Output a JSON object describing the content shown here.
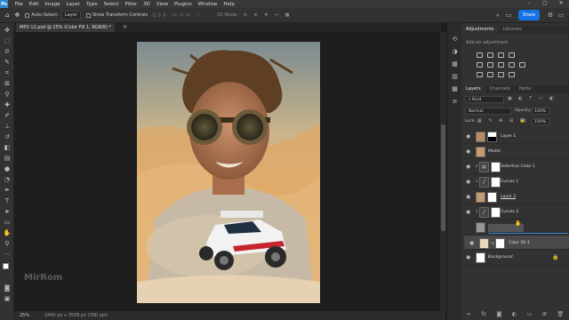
{
  "menubar": {
    "logo": "Ps",
    "items": [
      "File",
      "Edit",
      "Image",
      "Layer",
      "Type",
      "Select",
      "Filter",
      "3D",
      "View",
      "Plugins",
      "Window",
      "Help"
    ],
    "window_controls": [
      "–",
      "▢",
      "✕"
    ]
  },
  "options": {
    "auto_select_label": "Auto-Select:",
    "auto_select_value": "Layer",
    "show_transform_label": "Show Transform Controls",
    "mode_3d_label": "3D Mode:",
    "share_label": "Share"
  },
  "document": {
    "tab_label": "MP2-12.psd @ 25% (Color Fill 1, RGB/8) *",
    "zoom": "25%",
    "status": "2440 px x 3508 px (300 ppi)"
  },
  "watermark": "MirRom",
  "panels": {
    "top_tabs": [
      "Adjustments",
      "Libraries"
    ],
    "add_adjustment": "Add an adjustment",
    "layer_tabs": [
      "Layers",
      "Channels",
      "Paths"
    ],
    "kind_label": "Kind",
    "blend_mode": "Normal",
    "opacity_label": "Opacity:",
    "opacity_value": "100%",
    "lock_label": "Lock:",
    "fill_label": "Fill:",
    "fill_value": "100%"
  },
  "layers": [
    {
      "name": "Layer 1",
      "thumb": "photo-head",
      "style": ""
    },
    {
      "name": "Model",
      "thumb": "photo-face",
      "style": ""
    },
    {
      "name": "Selective Color 1",
      "thumb": "mask-white",
      "style": ""
    },
    {
      "name": "Curves 1",
      "thumb": "mask-white",
      "style": ""
    },
    {
      "name": "Layer 2",
      "thumb": "photo-sand",
      "style": "underline"
    },
    {
      "name": "Curves 2",
      "thumb": "mask-white",
      "style": ""
    },
    {
      "name": "Color Fill 1",
      "thumb": "color-fill",
      "style": "selected"
    },
    {
      "name": "Background",
      "thumb": "white",
      "style": "italic"
    }
  ],
  "colors": {
    "accent": "#1473e6",
    "photoshop_blue": "#2b89d4",
    "fill_color": "#e9d9b9"
  }
}
